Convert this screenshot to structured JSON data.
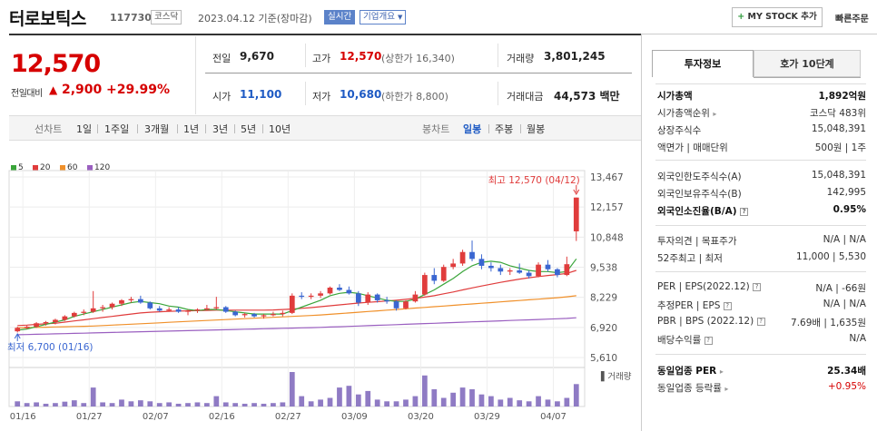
{
  "header": {
    "title": "터로보틱스",
    "code": "117730",
    "market": "코스닥",
    "date": "2023.04.12",
    "basis": "기준(장마감)",
    "live_badge": "실시간",
    "info_button": "기업개요",
    "mystock_button": "MY STOCK 추가",
    "quick_order": "빠른주문"
  },
  "price": {
    "current": "12,570",
    "change_label": "전일대비",
    "change": "2,900",
    "rate": "+29.99%"
  },
  "quote": {
    "prev_label": "전일",
    "prev": "9,670",
    "high_label": "고가",
    "high": "12,570",
    "upper_limit": "(상한가 16,340)",
    "volume_label": "거래량",
    "volume": "3,801,245",
    "open_label": "시가",
    "open": "11,100",
    "low_label": "저가",
    "low": "10,680",
    "lower_limit": "(하한가 8,800)",
    "amount_label": "거래대금",
    "amount": "44,573",
    "amount_unit": "백만"
  },
  "periods": {
    "line_label": "선차트",
    "items": [
      "1일",
      "1주일",
      "3개월",
      "1년",
      "3년",
      "5년",
      "10년"
    ],
    "candle_label": "봉차트",
    "candle_items": [
      "일봉",
      "주봉",
      "월봉"
    ],
    "active": "일봉"
  },
  "chart_data": {
    "type": "candlestick",
    "legend": [
      "5",
      "20",
      "60",
      "120"
    ],
    "legend_colors": [
      "#3aa53a",
      "#e03c3c",
      "#f0902a",
      "#9a5fc0"
    ],
    "y_ticks": [
      "13,467",
      "12,157",
      "10,848",
      "9,538",
      "8,229",
      "6,920",
      "5,610"
    ],
    "ylim": [
      5610,
      13467
    ],
    "x_ticks": [
      "01/16",
      "01/27",
      "02/07",
      "02/16",
      "02/27",
      "03/09",
      "03/20",
      "03/29",
      "04/07"
    ],
    "high_annotation": "최고 12,570 (04/12)",
    "low_annotation": "최저 6,700 (01/16)",
    "volume_label": "거래량",
    "candles": [
      [
        6750,
        6950,
        6700,
        6900
      ],
      [
        6900,
        7000,
        6850,
        6950
      ],
      [
        6950,
        7150,
        6900,
        7100
      ],
      [
        7100,
        7200,
        7000,
        7150
      ],
      [
        7150,
        7300,
        7050,
        7250
      ],
      [
        7250,
        7450,
        7200,
        7400
      ],
      [
        7400,
        7600,
        7350,
        7550
      ],
      [
        7550,
        7700,
        7450,
        7600
      ],
      [
        7600,
        8500,
        7550,
        7750
      ],
      [
        7750,
        7900,
        7600,
        7800
      ],
      [
        7800,
        8000,
        7700,
        7950
      ],
      [
        7950,
        8150,
        7850,
        8100
      ],
      [
        8100,
        8250,
        8000,
        8150
      ],
      [
        8150,
        8300,
        7950,
        8000
      ],
      [
        8000,
        8050,
        7700,
        7750
      ],
      [
        7750,
        7850,
        7600,
        7650
      ],
      [
        7650,
        7800,
        7600,
        7700
      ],
      [
        7700,
        7800,
        7550,
        7600
      ],
      [
        7600,
        7700,
        7450,
        7650
      ],
      [
        7650,
        7750,
        7550,
        7700
      ],
      [
        7700,
        7900,
        7650,
        7750
      ],
      [
        7750,
        8250,
        7700,
        7800
      ],
      [
        7800,
        7850,
        7550,
        7600
      ],
      [
        7600,
        7650,
        7400,
        7450
      ],
      [
        7450,
        7550,
        7350,
        7500
      ],
      [
        7500,
        7550,
        7350,
        7400
      ],
      [
        7400,
        7500,
        7300,
        7450
      ],
      [
        7450,
        7600,
        7400,
        7500
      ],
      [
        7500,
        7650,
        7400,
        7550
      ],
      [
        7550,
        8400,
        7500,
        8300
      ],
      [
        8300,
        8450,
        8150,
        8250
      ],
      [
        8250,
        8400,
        8150,
        8300
      ],
      [
        8300,
        8500,
        8200,
        8400
      ],
      [
        8400,
        8700,
        8350,
        8650
      ],
      [
        8650,
        8800,
        8500,
        8550
      ],
      [
        8550,
        8700,
        8350,
        8400
      ],
      [
        8400,
        8500,
        7850,
        8000
      ],
      [
        8000,
        8450,
        7900,
        8350
      ],
      [
        8350,
        8400,
        8000,
        8100
      ],
      [
        8100,
        8250,
        7950,
        8050
      ],
      [
        8050,
        8100,
        7650,
        7750
      ],
      [
        7750,
        8100,
        7700,
        8050
      ],
      [
        8050,
        8500,
        8000,
        8350
      ],
      [
        8350,
        9300,
        8300,
        9200
      ],
      [
        9200,
        9500,
        8800,
        8950
      ],
      [
        8950,
        9650,
        8900,
        9550
      ],
      [
        9550,
        9900,
        9450,
        9700
      ],
      [
        9700,
        10300,
        9600,
        10200
      ],
      [
        10200,
        10700,
        9800,
        9900
      ],
      [
        9900,
        10100,
        9450,
        9600
      ],
      [
        9600,
        9750,
        9350,
        9500
      ],
      [
        9500,
        9650,
        9200,
        9350
      ],
      [
        9350,
        9500,
        9200,
        9400
      ],
      [
        9400,
        9700,
        9250,
        9300
      ],
      [
        9300,
        9400,
        9050,
        9150
      ],
      [
        9150,
        9750,
        9100,
        9650
      ],
      [
        9650,
        9850,
        9350,
        9450
      ],
      [
        9450,
        9500,
        9100,
        9200
      ],
      [
        9200,
        10000,
        9150,
        9670
      ],
      [
        11100,
        12570,
        10680,
        12570
      ]
    ],
    "ma5": [
      6800,
      6850,
      6950,
      7050,
      7150,
      7250,
      7400,
      7500,
      7600,
      7700,
      7800,
      7900,
      8000,
      8050,
      8000,
      7950,
      7850,
      7800,
      7700,
      7650,
      7700,
      7700,
      7650,
      7600,
      7550,
      7500,
      7500,
      7500,
      7500,
      7650,
      7800,
      7950,
      8100,
      8300,
      8400,
      8450,
      8400,
      8300,
      8200,
      8100,
      8050,
      8050,
      8150,
      8350,
      8550,
      8800,
      9050,
      9350,
      9600,
      9750,
      9800,
      9750,
      9600,
      9500,
      9400,
      9350,
      9350,
      9300,
      9350,
      9900
    ],
    "ma20": [
      7000,
      7020,
      7050,
      7080,
      7100,
      7150,
      7200,
      7250,
      7300,
      7350,
      7400,
      7450,
      7500,
      7550,
      7580,
      7600,
      7620,
      7630,
      7640,
      7650,
      7660,
      7670,
      7670,
      7670,
      7670,
      7670,
      7670,
      7680,
      7700,
      7720,
      7750,
      7780,
      7820,
      7860,
      7900,
      7940,
      7980,
      8010,
      8040,
      8070,
      8100,
      8140,
      8180,
      8240,
      8300,
      8380,
      8460,
      8550,
      8640,
      8720,
      8800,
      8880,
      8950,
      9020,
      9080,
      9130,
      9180,
      9220,
      9270,
      9400
    ],
    "ma60": [
      6900,
      6910,
      6920,
      6930,
      6940,
      6950,
      6960,
      6970,
      6980,
      7000,
      7020,
      7040,
      7060,
      7080,
      7100,
      7120,
      7140,
      7160,
      7180,
      7200,
      7220,
      7240,
      7260,
      7280,
      7300,
      7320,
      7340,
      7360,
      7380,
      7400,
      7420,
      7440,
      7460,
      7490,
      7520,
      7550,
      7580,
      7610,
      7640,
      7670,
      7700,
      7730,
      7760,
      7790,
      7820,
      7850,
      7880,
      7910,
      7940,
      7970,
      8000,
      8030,
      8060,
      8090,
      8120,
      8150,
      8180,
      8210,
      8250,
      8300
    ],
    "ma120": [
      6600,
      6610,
      6620,
      6630,
      6640,
      6650,
      6660,
      6670,
      6680,
      6690,
      6700,
      6710,
      6720,
      6730,
      6740,
      6750,
      6760,
      6770,
      6780,
      6790,
      6800,
      6810,
      6820,
      6830,
      6840,
      6850,
      6860,
      6870,
      6880,
      6890,
      6900,
      6910,
      6920,
      6935,
      6950,
      6965,
      6980,
      6995,
      7010,
      7025,
      7040,
      7055,
      7070,
      7085,
      7100,
      7115,
      7130,
      7145,
      7160,
      7175,
      7190,
      7205,
      7220,
      7235,
      7250,
      7265,
      7280,
      7295,
      7310,
      7340
    ],
    "volume_rel": [
      0.15,
      0.1,
      0.12,
      0.08,
      0.1,
      0.14,
      0.18,
      0.1,
      0.55,
      0.12,
      0.1,
      0.2,
      0.15,
      0.18,
      0.15,
      0.1,
      0.12,
      0.08,
      0.1,
      0.12,
      0.1,
      0.3,
      0.12,
      0.1,
      0.08,
      0.1,
      0.08,
      0.1,
      0.12,
      1.0,
      0.3,
      0.15,
      0.2,
      0.25,
      0.55,
      0.6,
      0.35,
      0.45,
      0.2,
      0.15,
      0.15,
      0.2,
      0.3,
      0.9,
      0.5,
      0.25,
      0.4,
      0.55,
      0.5,
      0.35,
      0.3,
      0.2,
      0.25,
      0.18,
      0.15,
      0.3,
      0.2,
      0.15,
      0.25,
      0.65
    ]
  },
  "side": {
    "tab_active": "투자정보",
    "tab_other": "호가 10단계",
    "rows1": [
      {
        "label": "시가총액",
        "value": "1,892억원"
      },
      {
        "label": "시가총액순위",
        "value": "코스닥 483위"
      },
      {
        "label": "상장주식수",
        "value": "15,048,391"
      },
      {
        "label": "액면가 | 매매단위",
        "value": "500원 | 1주"
      }
    ],
    "rows2": [
      {
        "label": "외국인한도주식수(A)",
        "value": "15,048,391"
      },
      {
        "label": "외국인보유주식수(B)",
        "value": "142,995"
      },
      {
        "label": "외국인소진율(B/A)",
        "value": "0.95%"
      }
    ],
    "rows3": [
      {
        "label": "투자의견 | 목표주가",
        "value": "N/A | N/A"
      },
      {
        "label": "52주최고 | 최저",
        "value": "11,000 | 5,530"
      }
    ],
    "rows4": [
      {
        "label": "PER | EPS(2022.12)",
        "value": "N/A | -66원"
      },
      {
        "label": "추정PER | EPS",
        "value": "N/A | N/A"
      },
      {
        "label": "PBR | BPS (2022.12)",
        "value": "7.69배 | 1,635원"
      },
      {
        "label": "배당수익률",
        "value": "N/A"
      }
    ],
    "rows5": [
      {
        "label": "동일업종 PER",
        "value": "25.34배"
      },
      {
        "label": "동일업종 등락률",
        "value": "+0.95%"
      }
    ]
  }
}
